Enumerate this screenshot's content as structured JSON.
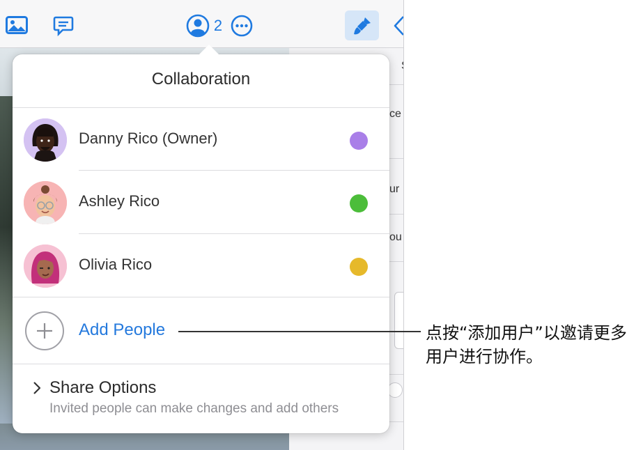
{
  "toolbar": {
    "collaborator_count": "2",
    "accent": "#1f7ae0"
  },
  "popover": {
    "title": "Collaboration",
    "people": [
      {
        "name": "Danny Rico (Owner)",
        "color": "#a97fe8"
      },
      {
        "name": "Ashley Rico",
        "color": "#4cbd3a"
      },
      {
        "name": "Olivia Rico",
        "color": "#e6b92b"
      }
    ],
    "add_people_label": "Add People",
    "share_options_label": "Share Options",
    "share_options_sub": "Invited people can make changes and add others"
  },
  "inspector": {
    "text_1": "S",
    "text_2": "ce",
    "text_3": "ur",
    "text_4": "ou"
  },
  "callout": {
    "text": "点按“添加用户”以邀请更多用户进行协作。"
  },
  "icons": [
    "photo-icon",
    "comment-icon",
    "collaboration-icon",
    "more-icon",
    "format-brush-icon",
    "back-chevron-icon",
    "plus-icon",
    "chevron-right-icon"
  ]
}
